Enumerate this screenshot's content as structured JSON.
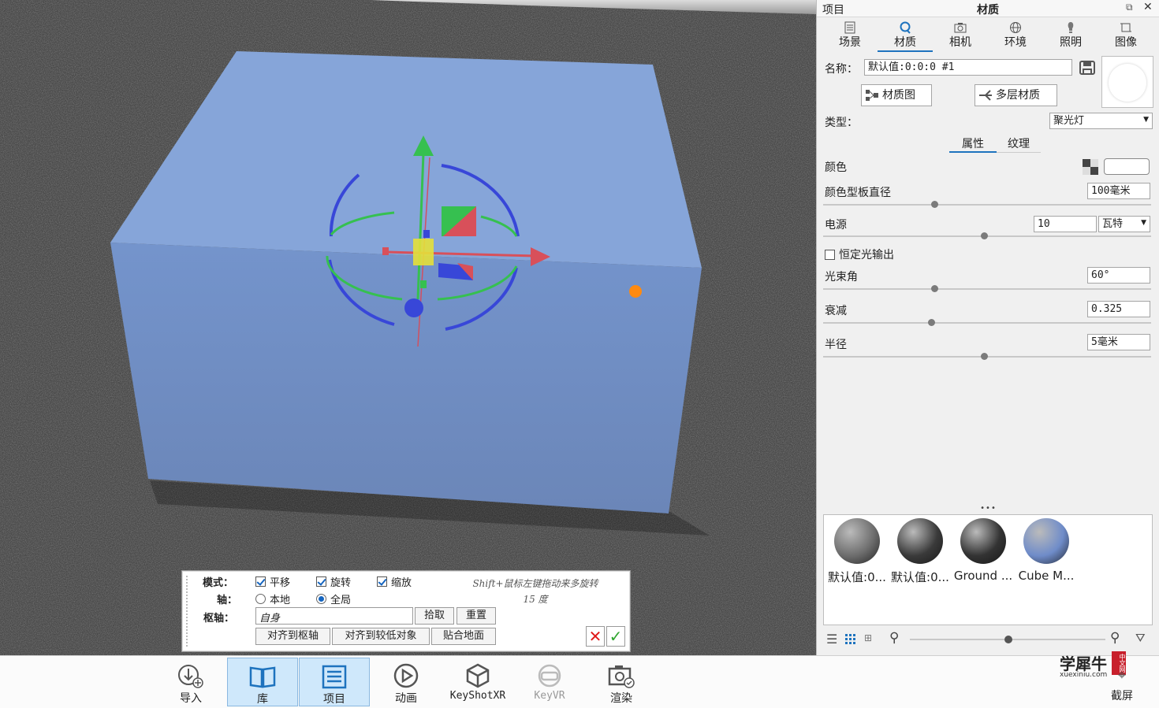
{
  "viewport": {
    "accent_colors": {
      "cube_top": "#87a6d8",
      "cube_front": "#6f8cc0",
      "orange_dot": "#ff8a10"
    }
  },
  "tool_panel": {
    "mode_label": "模式：",
    "axis_label": "轴：",
    "pivot_label": "枢轴：",
    "mode_options": [
      {
        "label": "平移",
        "checked": true
      },
      {
        "label": "旋转",
        "checked": true
      },
      {
        "label": "缩放",
        "checked": true
      }
    ],
    "axis_options": [
      {
        "label": "本地",
        "selected": false
      },
      {
        "label": "全局",
        "selected": true
      }
    ],
    "pivot_value": "自身",
    "pick_button": "拾取",
    "reset_button": "重置",
    "align_pivot_button": "对齐到枢轴",
    "align_lower_button": "对齐到较低对象",
    "snap_ground_button": "贴合地面",
    "hint_line1": "Shift+鼠标左键拖动来多旋转",
    "hint_line2": "15 度",
    "cancel_icon": "close-icon",
    "confirm_icon": "check-icon"
  },
  "bottom_toolbar": {
    "items": [
      {
        "label": "导入",
        "icon": "import-icon",
        "active": false
      },
      {
        "label": "库",
        "icon": "library-book-icon",
        "active": true
      },
      {
        "label": "项目",
        "icon": "project-list-icon",
        "active": true
      },
      {
        "label": "动画",
        "icon": "animation-play-icon",
        "active": false
      },
      {
        "label": "KeyShotXR",
        "icon": "keyshotxr-cube-icon",
        "active": false
      },
      {
        "label": "KeyVR",
        "icon": "keyvr-headset-icon",
        "active": false,
        "disabled": true
      },
      {
        "label": "渲染",
        "icon": "render-camera-icon",
        "active": false
      }
    ],
    "screenshot_label": "截屏",
    "watermark": {
      "main": "学犀牛",
      "sub": "xuexiniu.com",
      "badge": "中文网"
    }
  },
  "right_panel": {
    "header_left": "项目",
    "header_title": "材质",
    "tabs": [
      {
        "label": "场景",
        "icon": "scene-list-icon"
      },
      {
        "label": "材质",
        "icon": "material-ball-icon",
        "active": true
      },
      {
        "label": "相机",
        "icon": "camera-icon"
      },
      {
        "label": "环境",
        "icon": "globe-icon"
      },
      {
        "label": "照明",
        "icon": "bulb-icon"
      },
      {
        "label": "图像",
        "icon": "image-crop-icon"
      }
    ],
    "name_label": "名称：",
    "name_value": "默认值:0:0:0 #1",
    "material_graph_button": "材质图",
    "multi_layer_button": "多层材质",
    "type_label": "类型：",
    "type_value": "聚光灯",
    "sub_tabs": [
      {
        "label": "属性",
        "active": true
      },
      {
        "label": "纹理"
      }
    ],
    "props": {
      "color_label": "颜色",
      "color_template_label": "颜色型板直径",
      "color_template_value": "100毫米",
      "color_template_slider": 0.34,
      "power_label": "电源",
      "power_value": "10",
      "power_unit": "瓦特",
      "power_slider": 0.49,
      "constant_output_label": "恒定光输出",
      "constant_output_checked": false,
      "beam_angle_label": "光束角",
      "beam_angle_value": "60°",
      "beam_angle_slider": 0.34,
      "falloff_label": "衰减",
      "falloff_value": "0.325",
      "falloff_slider": 0.33,
      "radius_label": "半径",
      "radius_value": "5毫米",
      "radius_slider": 0.49
    },
    "more_dots": "•••",
    "materials": [
      {
        "label": "默认值:0...",
        "color": "#6d6d6d"
      },
      {
        "label": "默认值:0...",
        "color": "#3a3a3a"
      },
      {
        "label": "Ground ...",
        "color": "#333333"
      },
      {
        "label": "Cube M...",
        "color": "#6f8cc9"
      }
    ],
    "zoom_slider": 0.5
  }
}
